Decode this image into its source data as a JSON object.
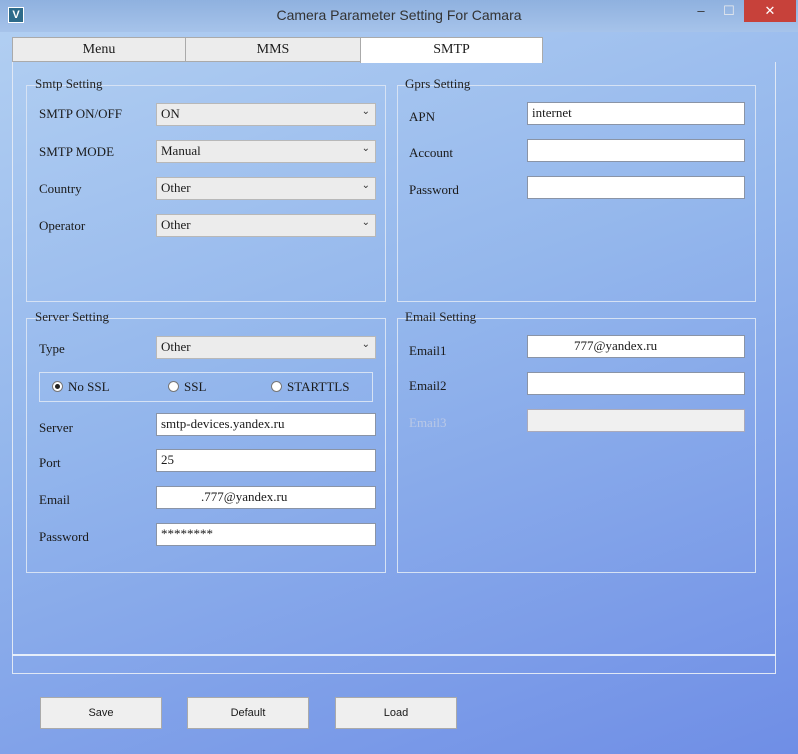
{
  "window": {
    "title": "Camera Parameter Setting For  Camara",
    "icon_letter": "V",
    "minimize": "‒",
    "maximize": "☐",
    "close": "✕"
  },
  "tabs": [
    {
      "label": "Menu"
    },
    {
      "label": "MMS"
    },
    {
      "label": "SMTP",
      "active": true
    }
  ],
  "smtp_setting": {
    "title": "Smtp Setting",
    "rows": [
      {
        "label": "SMTP ON/OFF",
        "value": "ON"
      },
      {
        "label": "SMTP MODE",
        "value": "Manual"
      },
      {
        "label": "Country",
        "value": "Other"
      },
      {
        "label": "Operator",
        "value": "Other"
      }
    ]
  },
  "gprs_setting": {
    "title": "Gprs Setting",
    "rows": [
      {
        "label": "APN",
        "value": "internet"
      },
      {
        "label": "Account",
        "value": ""
      },
      {
        "label": "Password",
        "value": ""
      }
    ]
  },
  "server_setting": {
    "title": "Server Setting",
    "type": {
      "label": "Type",
      "value": "Other"
    },
    "ssl_options": [
      {
        "label": "No SSL",
        "selected": true
      },
      {
        "label": "SSL",
        "selected": false
      },
      {
        "label": "STARTTLS",
        "selected": false
      }
    ],
    "server": {
      "label": "Server",
      "value": "smtp-devices.yandex.ru"
    },
    "port": {
      "label": "Port",
      "value": "25"
    },
    "email": {
      "label": "Email",
      "value": ".777@yandex.ru"
    },
    "password": {
      "label": "Password",
      "value": "********"
    }
  },
  "email_setting": {
    "title": "Email Setting",
    "rows": [
      {
        "label": "Email1",
        "value": "777@yandex.ru"
      },
      {
        "label": "Email2",
        "value": ""
      },
      {
        "label": "Email3",
        "value": "",
        "disabled": true
      }
    ]
  },
  "buttons": {
    "save": "Save",
    "default": "Default",
    "load": "Load"
  },
  "dropdown_arrow": "⌄"
}
